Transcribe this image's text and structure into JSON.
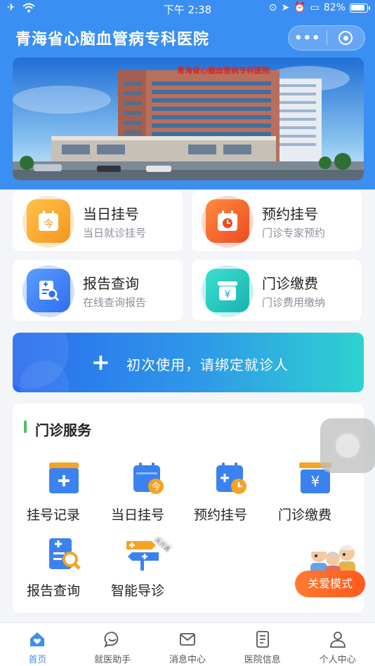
{
  "status_bar": {
    "time": "下午 2:38",
    "battery": "82%"
  },
  "header": {
    "app_title": "青海省心脑血管病专科医院",
    "more_icon": "more-dots-icon",
    "close_icon": "target-ring-icon"
  },
  "banner": {
    "sign_text": "青海省心脑血管病专科医院"
  },
  "quick_cards": [
    {
      "title": "当日挂号",
      "subtitle": "当日就诊挂号",
      "glyph": "今",
      "color": "#f6a323"
    },
    {
      "title": "预约挂号",
      "subtitle": "门诊专家预约",
      "glyph": "",
      "color": "#f1632e"
    },
    {
      "title": "报告查询",
      "subtitle": "在线查询报告",
      "glyph": "",
      "color": "#3b82f0"
    },
    {
      "title": "门诊缴费",
      "subtitle": "门诊费用缴纳",
      "glyph": "¥",
      "color": "#22c6c0"
    }
  ],
  "bind_bar": {
    "label": "初次使用，请绑定就诊人"
  },
  "services": {
    "title": "门诊服务",
    "items": [
      {
        "label": "挂号记录"
      },
      {
        "label": "当日挂号",
        "glyph": "今"
      },
      {
        "label": "预约挂号"
      },
      {
        "label": "门诊缴费",
        "glyph": "¥"
      },
      {
        "label": "报告查询"
      },
      {
        "label": "智能导诊",
        "badge": "未开通"
      }
    ]
  },
  "care_mode": {
    "label": "关爱模式"
  },
  "tabbar": {
    "items": [
      {
        "label": "首页",
        "icon": "home-heart-icon",
        "active": true
      },
      {
        "label": "就医助手",
        "icon": "chat-icon"
      },
      {
        "label": "消息中心",
        "icon": "mail-icon"
      },
      {
        "label": "医院信息",
        "icon": "document-icon"
      },
      {
        "label": "个人中心",
        "icon": "person-icon"
      }
    ]
  },
  "colors": {
    "primary": "#3b8ff2",
    "accent_green": "#4cc15b",
    "care_orange": "#ff6a25"
  }
}
